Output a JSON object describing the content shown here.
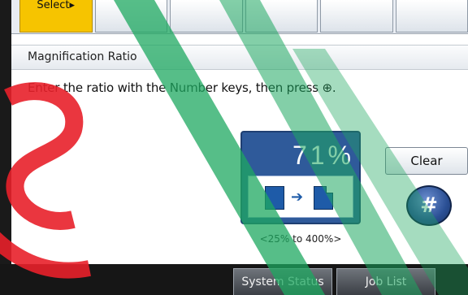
{
  "tabs": [
    {
      "label": "Select▸",
      "active": true
    },
    {
      "label": "",
      "active": false
    },
    {
      "label": "",
      "active": false
    },
    {
      "label": "",
      "active": false
    },
    {
      "label": "",
      "active": false
    },
    {
      "label": "",
      "active": false
    }
  ],
  "panel": {
    "title": "Magnification Ratio",
    "instruction": "Enter the ratio with the Number keys, then press ⊕."
  },
  "ratio": {
    "value": "71%",
    "range": "<25% to 400%>",
    "original_icon": "paper-icon",
    "result_icon": "paper-reduced-icon"
  },
  "buttons": {
    "clear": "Clear",
    "hash": "#"
  },
  "bottom_bar": {
    "system_status": "System Status",
    "job_list": "Job List"
  },
  "colors": {
    "active_tab": "#f6c400",
    "ratio_box": "#2f5a9a",
    "hash_key": "#2a4f94",
    "watermark_red": "#e8202a",
    "watermark_green": "#1ea860"
  }
}
